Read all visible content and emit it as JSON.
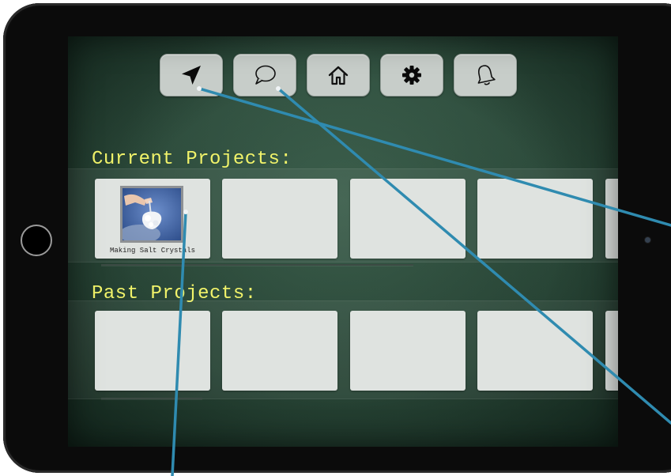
{
  "toolbar": {
    "buttons": [
      {
        "icon": "navigation-arrow-icon"
      },
      {
        "icon": "chat-bubble-icon"
      },
      {
        "icon": "home-icon"
      },
      {
        "icon": "gear-icon"
      },
      {
        "icon": "bell-icon"
      }
    ]
  },
  "current_projects": {
    "title": "Current Projects:",
    "tiles": [
      {
        "label": "Making Salt Crystals",
        "has_image": true
      },
      {
        "label": ""
      },
      {
        "label": ""
      },
      {
        "label": ""
      },
      {
        "label": ""
      }
    ]
  },
  "past_projects": {
    "title": "Past Projects:",
    "tiles": [
      {
        "label": ""
      },
      {
        "label": ""
      },
      {
        "label": ""
      },
      {
        "label": ""
      },
      {
        "label": ""
      }
    ]
  },
  "colors": {
    "title_yellow": "#f1f36a",
    "callout_blue": "#2f8bb0",
    "tile_bg": "#dfe3e0",
    "button_bg": "#c7cdc9"
  }
}
